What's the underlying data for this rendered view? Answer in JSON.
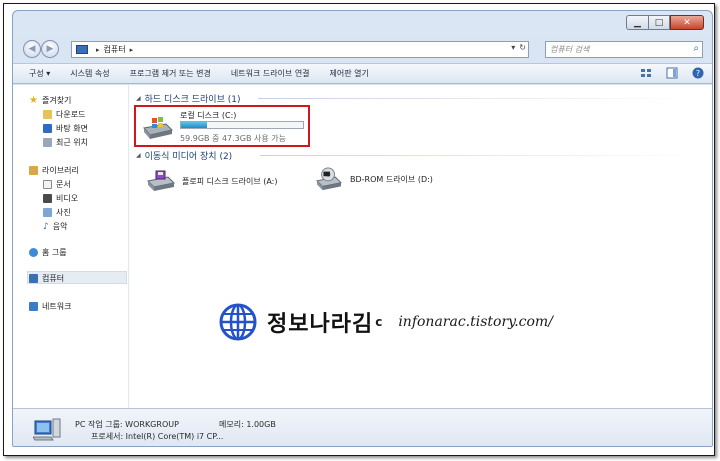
{
  "window": {
    "min_glyph": "▁",
    "max_glyph": "□",
    "close_glyph": "✕"
  },
  "address": {
    "crumb": "컴퓨터",
    "sep": "▸",
    "search_placeholder": "컴퓨터 검색"
  },
  "toolbar": {
    "items": [
      "구성 ▾",
      "시스템 속성",
      "프로그램 제거 또는 변경",
      "네트워크 드라이브 연결",
      "제어판 열기"
    ]
  },
  "nav": {
    "favorites": "즐겨찾기",
    "downloads": "다운로드",
    "desktop": "바탕 화면",
    "recent": "최근 위치",
    "libraries": "라이브러리",
    "documents": "문서",
    "videos": "비디오",
    "pictures": "사진",
    "music": "음악",
    "homegroup": "홈 그룹",
    "computer": "컴퓨터",
    "network": "네트워크"
  },
  "main": {
    "hdd_group": "하드 디스크 드라이브 (1)",
    "removable_group": "이동식 미디어 장치 (2)",
    "drive_c": {
      "name": "로컬 디스크 (C:)",
      "used_fraction": 0.21,
      "free_text": "59.9GB 중 47.3GB 사용 가능"
    },
    "floppy": "플로피 디스크 드라이브 (A:)",
    "bdrom": "BD-ROM 드라이브 (D:)"
  },
  "watermark": {
    "title": "정보나라김",
    "url": "infonarac.tistory.com/"
  },
  "details": {
    "workgroup": "PC 작업 그룹: WORKGROUP",
    "memory": "메모리: 1.00GB",
    "cpu": "프로세서: Intel(R) Core(TM) i7 CP..."
  },
  "colors": {
    "highlight_border": "#d0171d",
    "progress_fill": "#1d8dc6"
  }
}
